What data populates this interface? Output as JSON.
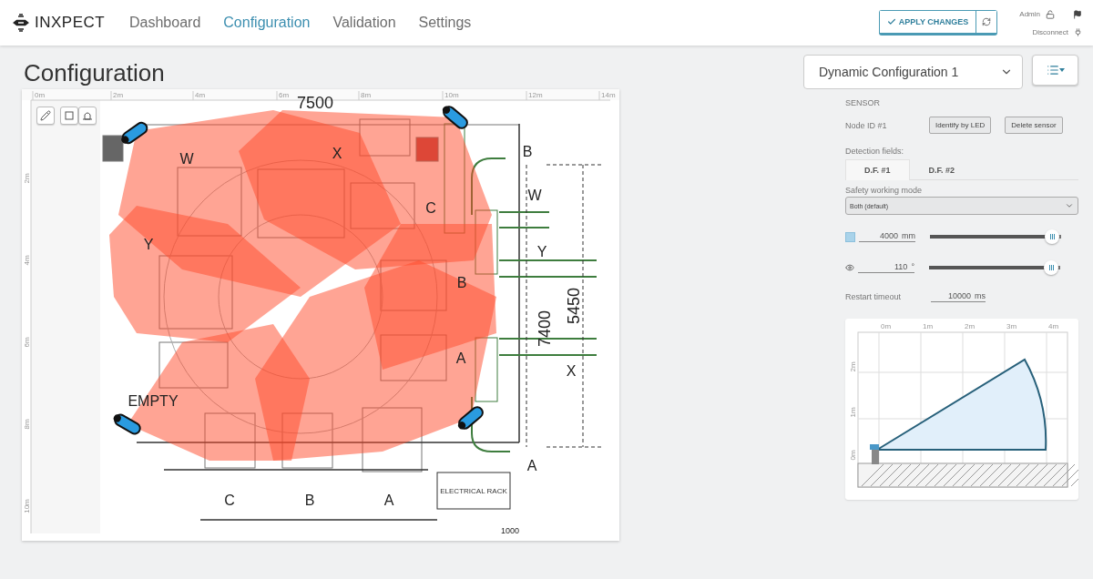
{
  "header": {
    "logo": "INXPECT",
    "nav": [
      {
        "label": "Dashboard",
        "selected": false
      },
      {
        "label": "Configuration",
        "selected": true
      },
      {
        "label": "Validation",
        "selected": false
      },
      {
        "label": "Settings",
        "selected": false
      }
    ],
    "apply_button": "APPLY CHANGES",
    "user": "Admin",
    "disconnect": "Disconnect"
  },
  "page_title": "Configuration",
  "plan": {
    "x_ticks": [
      "0m",
      "2m",
      "4m",
      "6m",
      "8m",
      "10m",
      "12m",
      "14m"
    ],
    "y_ticks": [
      "2m",
      "4m",
      "6m",
      "8m",
      "10m"
    ],
    "labels": [
      {
        "text": "7500",
        "kind": "dimension"
      },
      {
        "text": "W",
        "kind": "zone"
      },
      {
        "text": "X",
        "kind": "zone"
      },
      {
        "text": "Y",
        "kind": "zone"
      },
      {
        "text": "C",
        "kind": "zone"
      },
      {
        "text": "B",
        "kind": "zone"
      },
      {
        "text": "A",
        "kind": "zone"
      },
      {
        "text": "B",
        "kind": "zone"
      },
      {
        "text": "W",
        "kind": "zone"
      },
      {
        "text": "Y",
        "kind": "zone"
      },
      {
        "text": "X",
        "kind": "zone"
      },
      {
        "text": "A",
        "kind": "zone"
      },
      {
        "text": "7400",
        "kind": "vertical"
      },
      {
        "text": "5450",
        "kind": "vertical"
      },
      {
        "text": "EMPTY",
        "kind": "zone"
      },
      {
        "text": "C",
        "kind": "zone"
      },
      {
        "text": "B",
        "kind": "zone"
      },
      {
        "text": "A",
        "kind": "zone"
      },
      {
        "text": "ELECTRICAL RACK",
        "kind": "note"
      },
      {
        "text": "1000",
        "kind": "dimension"
      }
    ]
  },
  "config_select": {
    "value": "Dynamic Configuration 1"
  },
  "sensor": {
    "heading": "SENSOR",
    "node": "Node ID #1",
    "buttons": [
      "Identify by LED",
      "Delete sensor"
    ],
    "fields_label": "Detection fields:",
    "tabs": [
      {
        "label": "D.F. #1",
        "selected": true
      },
      {
        "label": "D.F. #2",
        "selected": false
      }
    ],
    "mode_label": "Safety working mode",
    "mode_value": "Both (default)",
    "range": {
      "value": "4000",
      "unit": "mm",
      "level": 0.96
    },
    "angle": {
      "value": "110",
      "unit": "°",
      "level": 0.96
    },
    "restart": {
      "label": "Restart timeout",
      "value": "10000",
      "unit": "ms"
    }
  },
  "side_view": {
    "x_ticks": [
      "0m",
      "1m",
      "2m",
      "3m",
      "4m"
    ],
    "y_ticks": [
      "2m",
      "1m",
      "0m"
    ]
  }
}
